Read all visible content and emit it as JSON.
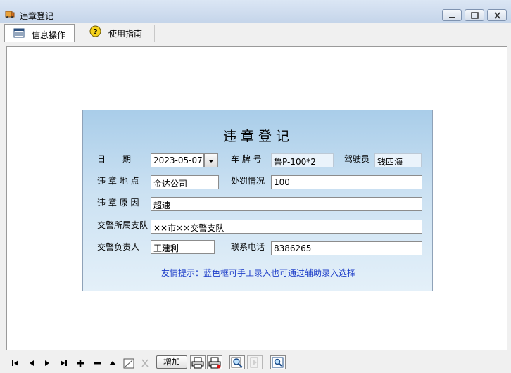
{
  "window": {
    "title": "违章登记"
  },
  "tabs": [
    {
      "label": "信息操作"
    },
    {
      "label": "使用指南"
    }
  ],
  "form": {
    "title": "违章登记",
    "labels": {
      "date": "日　　期",
      "plate": "车 牌 号",
      "driver": "驾驶员",
      "location": "违 章 地 点",
      "penalty": "处罚情况",
      "reason": "违 章 原 因",
      "squad": "交警所属支队",
      "officer": "交警负责人",
      "phone": "联系电话"
    },
    "values": {
      "date": "2023-05-07",
      "plate": "鲁P-100*2",
      "driver": "钱四海",
      "location": "金达公司",
      "penalty": "100",
      "reason": "超速",
      "squad": "××市××交警支队",
      "officer": "王建利",
      "phone": "8386265"
    },
    "hint": "友情提示：蓝色框可手工录入也可通过辅助录入选择"
  },
  "toolbar": {
    "add_label": "增加"
  }
}
